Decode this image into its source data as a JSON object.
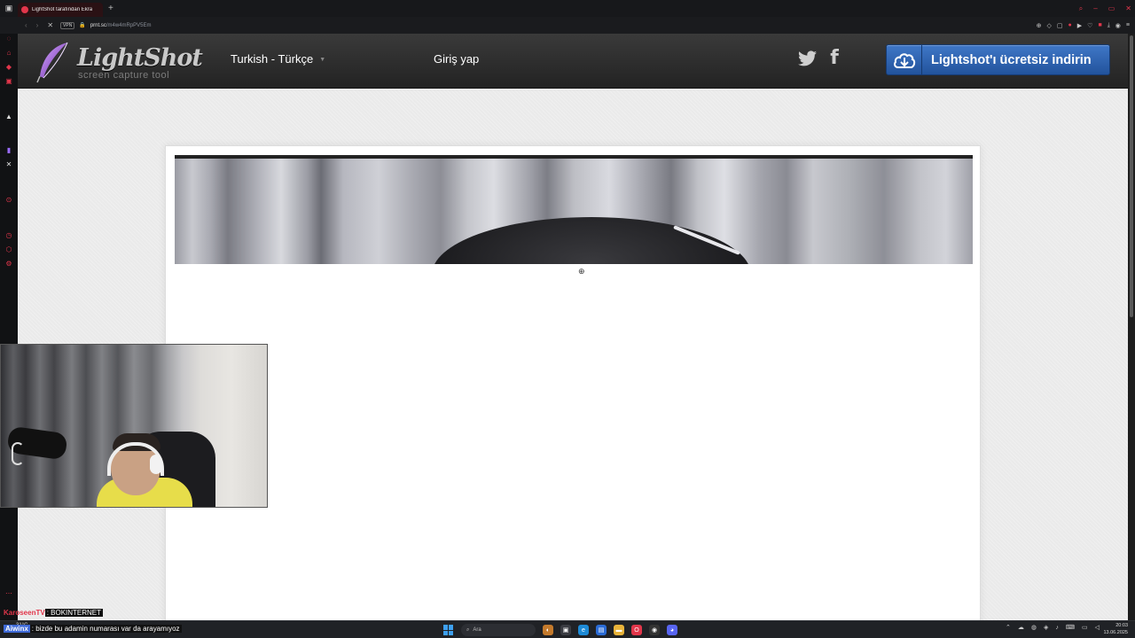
{
  "browser": {
    "tab_title": "LightShot tarafından Ekra",
    "new_tab_glyph": "+",
    "url_domain": "prnt.sc",
    "url_path": "/m4w4mRpPV5Em",
    "vpn_label": "VPN"
  },
  "header": {
    "logo_title": "LightShot",
    "logo_subtitle": "screen capture tool",
    "language": "Turkish - Türkçe",
    "login": "Giriş yap",
    "download": "Lightshot'ı ücretsiz indirin",
    "facebook_glyph": "f"
  },
  "chat": {
    "line1_user": "KaroseenTV",
    "line1_msg": ": BOKINTERNET",
    "line2_user": "Aiwinx",
    "line2_msg": ": bizde bu adamin numarası var da arayamıyoz"
  },
  "taskbar": {
    "weather": "31°C",
    "search_label": "Ara",
    "time": "20:03",
    "date": "13.06.2025"
  },
  "colors": {
    "accent_red": "#e2364b",
    "download_blue": "#2f63b0",
    "header_dark": "#2b2b2b"
  }
}
